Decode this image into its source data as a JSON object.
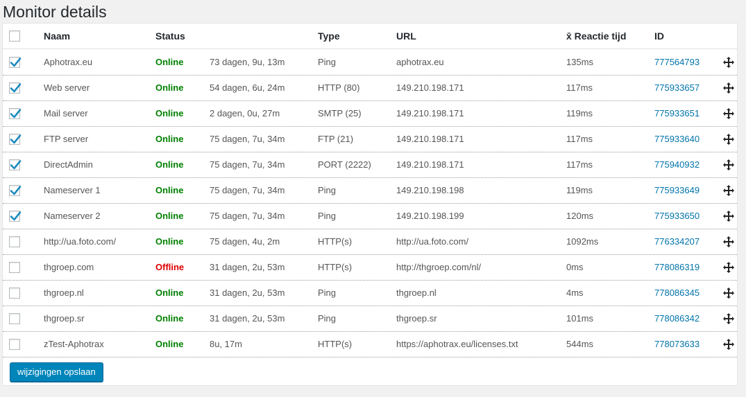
{
  "page": {
    "title": "Monitor details"
  },
  "table": {
    "headers": {
      "name": "Naam",
      "status": "Status",
      "type": "Type",
      "url": "URL",
      "response": "x̄ Reactie tijd",
      "id": "ID"
    },
    "select_all_checked": false,
    "rows": [
      {
        "checked": true,
        "name": "Aphotrax.eu",
        "status": "Online",
        "status_kind": "online",
        "uptime": "73 dagen, 9u, 13m",
        "type": "Ping",
        "url": "aphotrax.eu",
        "response": "135ms",
        "id": "777564793"
      },
      {
        "checked": true,
        "name": "Web server",
        "status": "Online",
        "status_kind": "online",
        "uptime": "54 dagen, 6u, 24m",
        "type": "HTTP (80)",
        "url": "149.210.198.171",
        "response": "117ms",
        "id": "775933657"
      },
      {
        "checked": true,
        "name": "Mail server",
        "status": "Online",
        "status_kind": "online",
        "uptime": "2 dagen, 0u, 27m",
        "type": "SMTP (25)",
        "url": "149.210.198.171",
        "response": "119ms",
        "id": "775933651"
      },
      {
        "checked": true,
        "name": "FTP server",
        "status": "Online",
        "status_kind": "online",
        "uptime": "75 dagen, 7u, 34m",
        "type": "FTP (21)",
        "url": "149.210.198.171",
        "response": "117ms",
        "id": "775933640"
      },
      {
        "checked": true,
        "name": "DirectAdmin",
        "status": "Online",
        "status_kind": "online",
        "uptime": "75 dagen, 7u, 34m",
        "type": "PORT (2222)",
        "url": "149.210.198.171",
        "response": "117ms",
        "id": "775940932"
      },
      {
        "checked": true,
        "name": "Nameserver 1",
        "status": "Online",
        "status_kind": "online",
        "uptime": "75 dagen, 7u, 34m",
        "type": "Ping",
        "url": "149.210.198.198",
        "response": "119ms",
        "id": "775933649"
      },
      {
        "checked": true,
        "name": "Nameserver 2",
        "status": "Online",
        "status_kind": "online",
        "uptime": "75 dagen, 7u, 34m",
        "type": "Ping",
        "url": "149.210.198.199",
        "response": "120ms",
        "id": "775933650"
      },
      {
        "checked": false,
        "name": "http://ua.foto.com/",
        "status": "Online",
        "status_kind": "online",
        "uptime": "75 dagen, 4u, 2m",
        "type": "HTTP(s)",
        "url": "http://ua.foto.com/",
        "response": "1092ms",
        "id": "776334207"
      },
      {
        "checked": false,
        "name": "thgroep.com",
        "status": "Offline",
        "status_kind": "offline",
        "uptime": "31 dagen, 2u, 53m",
        "type": "HTTP(s)",
        "url": "http://thgroep.com/nl/",
        "response": "0ms",
        "id": "778086319"
      },
      {
        "checked": false,
        "name": "thgroep.nl",
        "status": "Online",
        "status_kind": "online",
        "uptime": "31 dagen, 2u, 53m",
        "type": "Ping",
        "url": "thgroep.nl",
        "response": "4ms",
        "id": "778086345"
      },
      {
        "checked": false,
        "name": "thgroep.sr",
        "status": "Online",
        "status_kind": "online",
        "uptime": "31 dagen, 2u, 53m",
        "type": "Ping",
        "url": "thgroep.sr",
        "response": "101ms",
        "id": "778086342"
      },
      {
        "checked": false,
        "name": "zTest-Aphotrax",
        "status": "Online",
        "status_kind": "online",
        "uptime": "8u, 17m",
        "type": "HTTP(s)",
        "url": "https://aphotrax.eu/licenses.txt",
        "response": "544ms",
        "id": "778073633"
      }
    ]
  },
  "actions": {
    "save_label": "wijzigingen opslaan"
  },
  "colors": {
    "online": "#008000",
    "offline": "#dd0000",
    "link": "#0073aa",
    "primary_button": "#0085ba",
    "check": "#1e8cbe"
  },
  "icons": {
    "row_handle": "move-arrows-icon",
    "checkbox_mark": "checkmark-icon"
  }
}
